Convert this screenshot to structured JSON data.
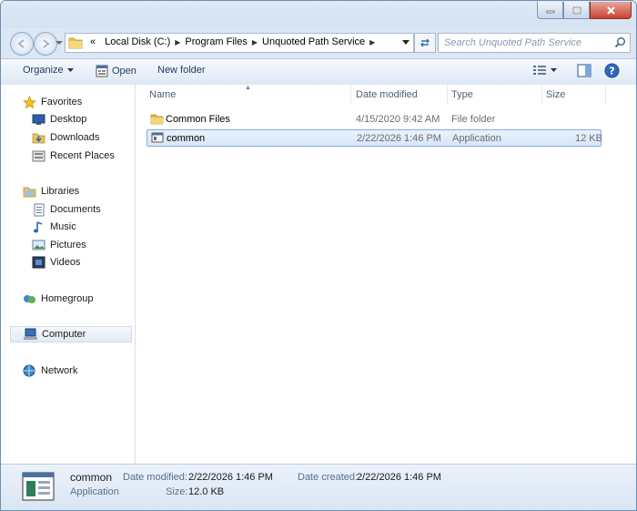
{
  "window": {
    "caption": {
      "minimize": "minimize",
      "maximize": "maximize",
      "close": "close"
    }
  },
  "address": {
    "prefix": "«",
    "crumbs": [
      "Local Disk (C:)",
      "Program Files",
      "Unquoted Path Service"
    ]
  },
  "search": {
    "placeholder": "Search Unquoted Path Service"
  },
  "toolbar": {
    "organize": "Organize",
    "open": "Open",
    "new_folder": "New folder"
  },
  "nav": {
    "favorites": "Favorites",
    "desktop": "Desktop",
    "downloads": "Downloads",
    "recent_places": "Recent Places",
    "libraries": "Libraries",
    "documents": "Documents",
    "music": "Music",
    "pictures": "Pictures",
    "videos": "Videos",
    "homegroup": "Homegroup",
    "computer": "Computer",
    "network": "Network"
  },
  "columns": {
    "name": "Name",
    "date_modified": "Date modified",
    "type": "Type",
    "size": "Size"
  },
  "files": [
    {
      "name": "Common Files",
      "date": "4/15/2020 9:42 AM",
      "type": "File folder",
      "size": "",
      "icon": "folder-icon"
    },
    {
      "name": "common",
      "date": "2/22/2026 1:46 PM",
      "type": "Application",
      "size": "12 KB",
      "icon": "application-icon"
    }
  ],
  "details": {
    "name": "common",
    "type": "Application",
    "date_modified_label": "Date modified:",
    "date_modified": "2/22/2026 1:46 PM",
    "size_label": "Size:",
    "size": "12.0 KB",
    "date_created_label": "Date created:",
    "date_created": "2/22/2026 1:46 PM"
  }
}
